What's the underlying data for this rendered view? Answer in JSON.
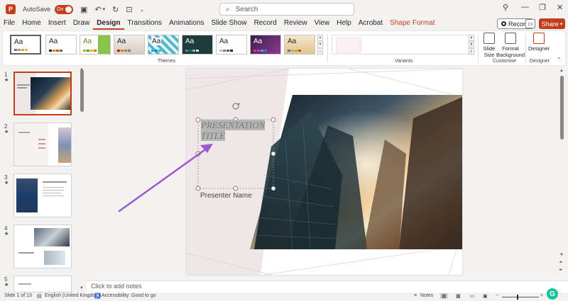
{
  "titlebar": {
    "autosave_label": "AutoSave",
    "autosave_state": "On",
    "search_placeholder": "Search"
  },
  "tabs": [
    "File",
    "Home",
    "Insert",
    "Draw",
    "Design",
    "Transitions",
    "Animations",
    "Slide Show",
    "Record",
    "Review",
    "View",
    "Help",
    "Acrobat",
    "Shape Format"
  ],
  "active_tab": "Design",
  "record_label": "Record",
  "share_label": "Share",
  "ribbon": {
    "themes_label": "Themes",
    "variants_label": "Variants",
    "customise_label": "Customise",
    "designer_group_label": "Designer",
    "slide_size_label": "Slide Size",
    "format_background_label": "Format Background",
    "designer_label": "Designer",
    "theme_text": "Aa"
  },
  "thumbnails": [
    {
      "num": "1",
      "star": "★"
    },
    {
      "num": "2",
      "star": "★"
    },
    {
      "num": "3",
      "star": "★"
    },
    {
      "num": "4",
      "star": "★"
    },
    {
      "num": "5",
      "star": "★"
    }
  ],
  "slide": {
    "title": "PRESENTATION TITLE",
    "presenter": "Presenter Name"
  },
  "notes_placeholder": "Click to add notes",
  "status": {
    "slide_info": "Slide 1 of 13",
    "language": "English (United Kingdom)",
    "accessibility": "Accessibility: Good to go",
    "notes": "Notes"
  },
  "colors": {
    "accent": "#c43e1c",
    "annotation_arrow": "#9b59d0"
  }
}
